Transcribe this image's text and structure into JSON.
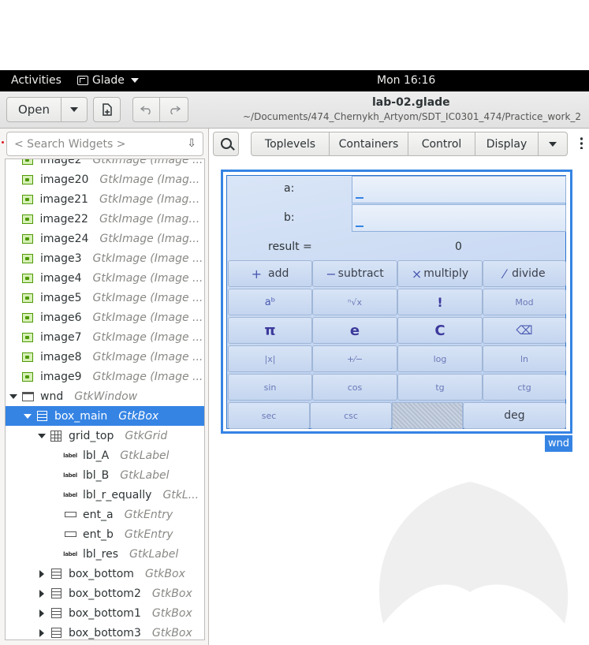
{
  "topbar": {
    "activities": "Activities",
    "app_name": "Glade",
    "clock": "Mon 16:16"
  },
  "headerbar": {
    "open_label": "Open",
    "title": "lab-02.glade",
    "subtitle": "~/Documents/474_Chernykh_Artyom/SDT_IC0301_474/Practice_work_2",
    "undo_icon": "undo-icon",
    "redo_icon": "redo-icon",
    "new_icon": "new-document-icon"
  },
  "inspector": {
    "search_placeholder": "< Search Widgets >",
    "rows": [
      {
        "name": "image2",
        "type": "GtkImage (Image ...",
        "icon": "image"
      },
      {
        "name": "image20",
        "type": "GtkImage (Imag...",
        "icon": "image"
      },
      {
        "name": "image21",
        "type": "GtkImage (Image...",
        "icon": "image"
      },
      {
        "name": "image22",
        "type": "GtkImage (Image...",
        "icon": "image"
      },
      {
        "name": "image24",
        "type": "GtkImage (Imag...",
        "icon": "image"
      },
      {
        "name": "image3",
        "type": "GtkImage (Image ...",
        "icon": "image"
      },
      {
        "name": "image4",
        "type": "GtkImage (Image ...",
        "icon": "image"
      },
      {
        "name": "image5",
        "type": "GtkImage (Image ...",
        "icon": "image"
      },
      {
        "name": "image6",
        "type": "GtkImage (Image ...",
        "icon": "image"
      },
      {
        "name": "image7",
        "type": "GtkImage (Image ...",
        "icon": "image"
      },
      {
        "name": "image8",
        "type": "GtkImage (Image ...",
        "icon": "image"
      },
      {
        "name": "image9",
        "type": "GtkImage (Image ...",
        "icon": "image"
      },
      {
        "name": "wnd",
        "type": "GtkWindow",
        "icon": "window"
      },
      {
        "name": "box_main",
        "type": "GtkBox",
        "icon": "box"
      },
      {
        "name": "grid_top",
        "type": "GtkGrid",
        "icon": "grid"
      },
      {
        "name": "lbl_A",
        "type": "GtkLabel",
        "icon": "label"
      },
      {
        "name": "lbl_B",
        "type": "GtkLabel",
        "icon": "label"
      },
      {
        "name": "lbl_r_equally",
        "type": "GtkL...",
        "icon": "label"
      },
      {
        "name": "ent_a",
        "type": "GtkEntry",
        "icon": "entry"
      },
      {
        "name": "ent_b",
        "type": "GtkEntry",
        "icon": "entry"
      },
      {
        "name": "lbl_res",
        "type": "GtkLabel",
        "icon": "label"
      },
      {
        "name": "box_bottom",
        "type": "GtkBox",
        "icon": "box"
      },
      {
        "name": "box_bottom2",
        "type": "GtkBox",
        "icon": "box"
      },
      {
        "name": "box_bottom1",
        "type": "GtkBox",
        "icon": "box"
      },
      {
        "name": "box_bottom3",
        "type": "GtkBox",
        "icon": "box"
      }
    ],
    "label_icon_text": "label"
  },
  "palette": {
    "tabs": [
      "Toplevels",
      "Containers",
      "Control",
      "Display"
    ]
  },
  "calculator": {
    "label_a": "a:",
    "label_b": "b:",
    "label_result": "result =",
    "result_value": "0",
    "ops": {
      "add": "add",
      "subtract": "subtract",
      "multiply": "multiply",
      "divide": "divide"
    },
    "glyphs": {
      "power": "aᵇ",
      "root": "ⁿ√x",
      "factorial": "!",
      "mod": "Mod",
      "pi": "π",
      "e": "e",
      "clear": "C",
      "backspace": "⌫",
      "abs": "|x|",
      "plusminus": "+⁄−",
      "log": "log",
      "ln": "ln",
      "sin": "sin",
      "cos": "cos",
      "tg": "tg",
      "ctg": "ctg",
      "sec": "sec",
      "csc": "csc"
    },
    "deg_label": "deg"
  },
  "window_tag": "wnd"
}
